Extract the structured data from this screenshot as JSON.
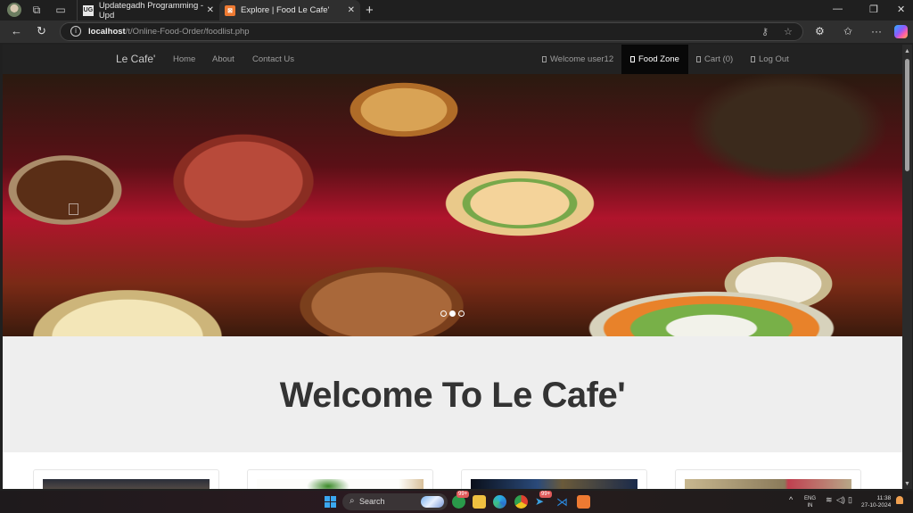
{
  "browser": {
    "tabs": [
      {
        "title": "Updategadh Programming - Upd",
        "favicon": "UG",
        "active": false
      },
      {
        "title": "Explore | Food Le Cafe'",
        "favicon": "xampp-icon",
        "active": true
      }
    ],
    "new_tab_icon": "+",
    "url_host": "localhost",
    "url_path": "/t/Online-Food-Order/foodlist.php"
  },
  "site": {
    "brand": "Le Cafe'",
    "nav_left": [
      "Home",
      "About",
      "Contact Us"
    ],
    "nav_right": [
      {
        "label": "Welcome user12",
        "active": false
      },
      {
        "label": "Food Zone",
        "active": true
      },
      {
        "label": "Cart (0)",
        "active": false
      },
      {
        "label": "Log Out",
        "active": false
      }
    ],
    "carousel": {
      "slides": 3,
      "active_index": 1
    },
    "jumbotron_title": "Welcome To Le Cafe'",
    "cards_visible": 4
  },
  "taskbar": {
    "search_label": "Search",
    "whatsapp_badge": "99+",
    "telegram_badge": "99+",
    "language": "ENG",
    "region": "IN",
    "time": "11:38",
    "date": "27-10-2024"
  }
}
